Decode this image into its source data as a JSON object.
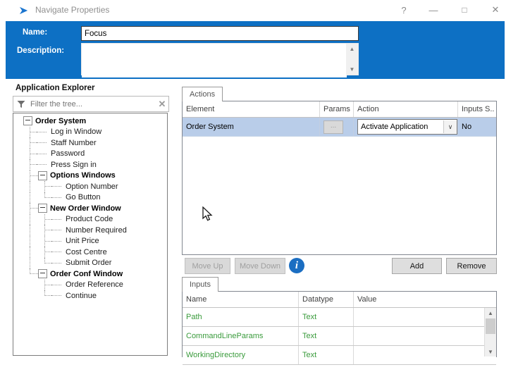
{
  "window": {
    "title": "Navigate Properties",
    "controls": {
      "help": "?",
      "minimize": "—",
      "maximize": "□",
      "close": "✕"
    }
  },
  "properties_header": {
    "name_label": "Name:",
    "name_value": "Focus",
    "description_label": "Description:",
    "description_value": ""
  },
  "explorer": {
    "title": "Application Explorer",
    "filter_placeholder": "Filter the tree...",
    "clear_glyph": "✕",
    "tree": [
      {
        "label": "Order System",
        "bold": true,
        "prefix": [],
        "slot": "box"
      },
      {
        "label": "Log in Window",
        "bold": false,
        "prefix": [
          "t"
        ],
        "slot": "dash"
      },
      {
        "label": "Staff Number",
        "bold": false,
        "prefix": [
          "t"
        ],
        "slot": "dash"
      },
      {
        "label": "Password",
        "bold": false,
        "prefix": [
          "t"
        ],
        "slot": "dash"
      },
      {
        "label": "Press Sign in",
        "bold": false,
        "prefix": [
          "t"
        ],
        "slot": "dash"
      },
      {
        "label": "Options Windows",
        "bold": true,
        "prefix": [
          "t"
        ],
        "slot": "box"
      },
      {
        "label": "Option Number",
        "bold": false,
        "prefix": [
          "v",
          "t"
        ],
        "slot": "dash"
      },
      {
        "label": "Go Button",
        "bold": false,
        "prefix": [
          "v",
          "l"
        ],
        "slot": "dash"
      },
      {
        "label": "New Order Window",
        "bold": true,
        "prefix": [
          "t"
        ],
        "slot": "box"
      },
      {
        "label": "Product Code",
        "bold": false,
        "prefix": [
          "v",
          "t"
        ],
        "slot": "dash"
      },
      {
        "label": "Number Required",
        "bold": false,
        "prefix": [
          "v",
          "t"
        ],
        "slot": "dash"
      },
      {
        "label": "Unit Price",
        "bold": false,
        "prefix": [
          "v",
          "t"
        ],
        "slot": "dash"
      },
      {
        "label": "Cost Centre",
        "bold": false,
        "prefix": [
          "v",
          "t"
        ],
        "slot": "dash"
      },
      {
        "label": "Submit Order",
        "bold": false,
        "prefix": [
          "v",
          "l"
        ],
        "slot": "dash"
      },
      {
        "label": "Order Conf Window",
        "bold": true,
        "prefix": [
          "l"
        ],
        "slot": "box"
      },
      {
        "label": "Order Reference",
        "bold": false,
        "prefix": [
          "b",
          "t"
        ],
        "slot": "dash"
      },
      {
        "label": "Continue",
        "bold": false,
        "prefix": [
          "b",
          "l"
        ],
        "slot": "dash"
      }
    ]
  },
  "actions": {
    "tab": "Actions",
    "columns": [
      "Element",
      "Params",
      "Action",
      "Inputs S.."
    ],
    "row": {
      "element": "Order System",
      "params_button": "...",
      "action": "Activate Application",
      "dropdown_glyph": "∨",
      "inputs_set": "No"
    },
    "buttons": {
      "move_up": "Move Up",
      "move_down": "Move Down",
      "add": "Add",
      "remove": "Remove"
    },
    "info_glyph": "i"
  },
  "inputs": {
    "tab": "Inputs",
    "columns": [
      "Name",
      "Datatype",
      "Value"
    ],
    "rows": [
      {
        "name": "Path",
        "datatype": "Text",
        "value": ""
      },
      {
        "name": "CommandLineParams",
        "datatype": "Text",
        "value": ""
      },
      {
        "name": "WorkingDirectory",
        "datatype": "Text",
        "value": ""
      }
    ]
  },
  "colors": {
    "header_blue": "#0d70c4",
    "selected_row": "#b9cde9",
    "param_green": "#3a9b3c",
    "info_blue": "#1b6ec2"
  }
}
